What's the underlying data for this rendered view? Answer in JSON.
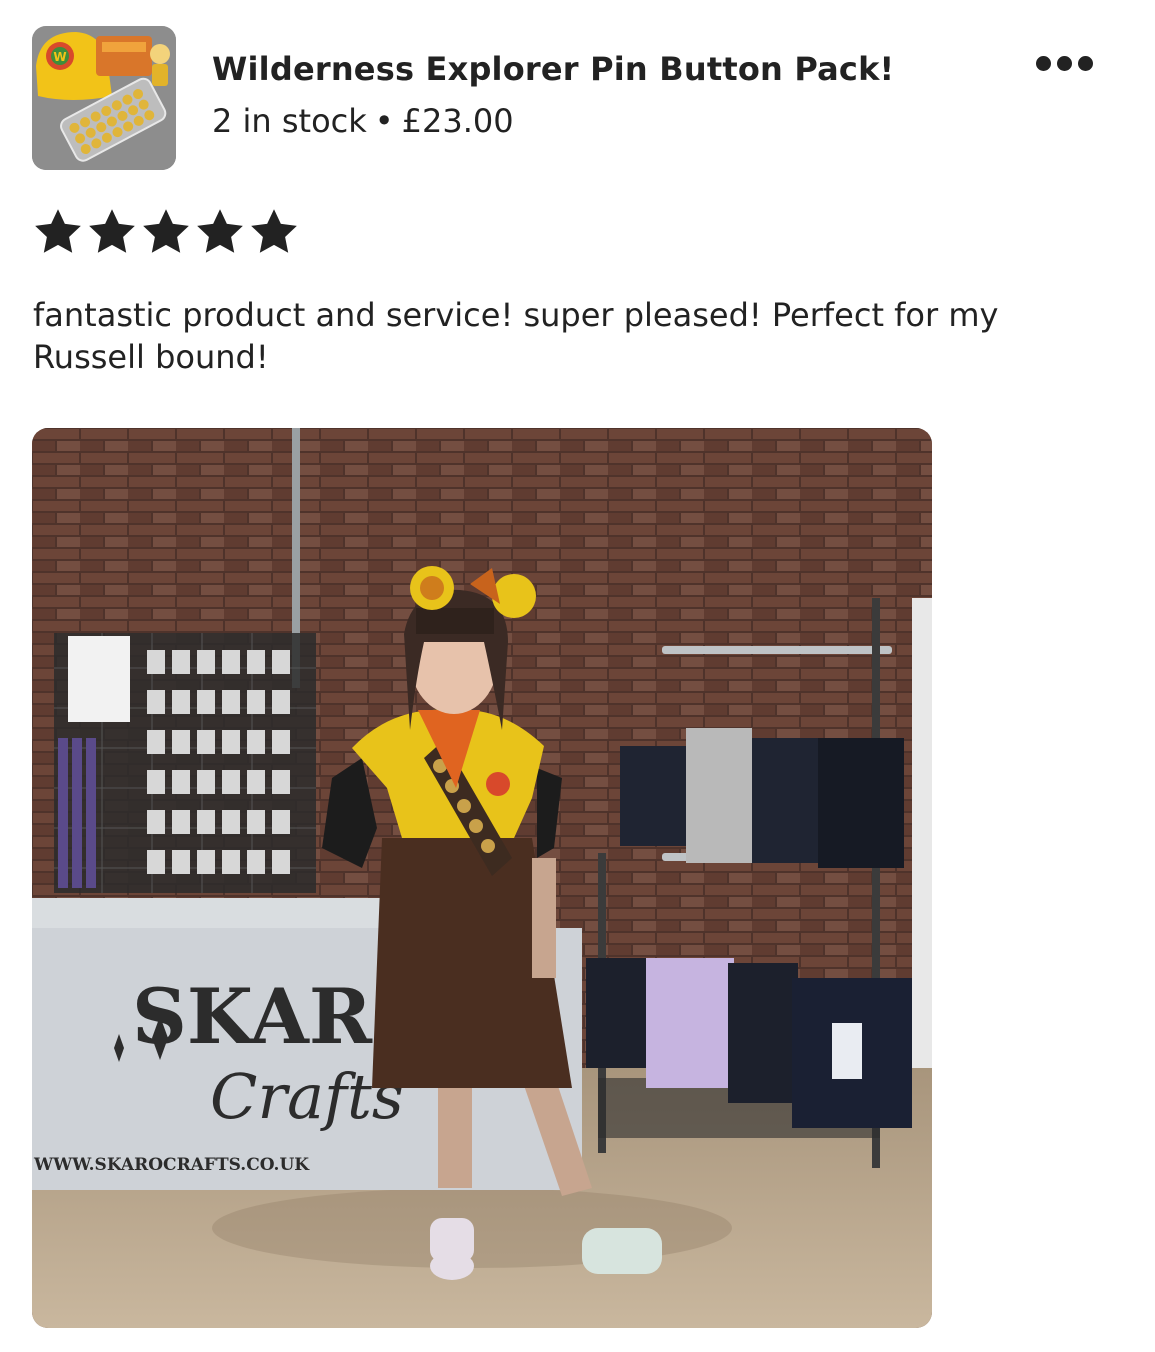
{
  "listing": {
    "title": "Wilderness Explorer Pin Button Pack!",
    "stock": "2 in stock",
    "separator": "•",
    "price": "£23.00",
    "thumbnail_icon": "product-thumbnail"
  },
  "menu": {
    "icon": "more-options-icon"
  },
  "review": {
    "rating": 5,
    "rating_max": 5,
    "text": "fantastic product and service! super pleased! Perfect for my Russell bound!"
  },
  "photo": {
    "banner_brand": "SKARO",
    "banner_script": "Crafts",
    "banner_url": "WWW.SKAROCRAFTS.CO.UK"
  }
}
